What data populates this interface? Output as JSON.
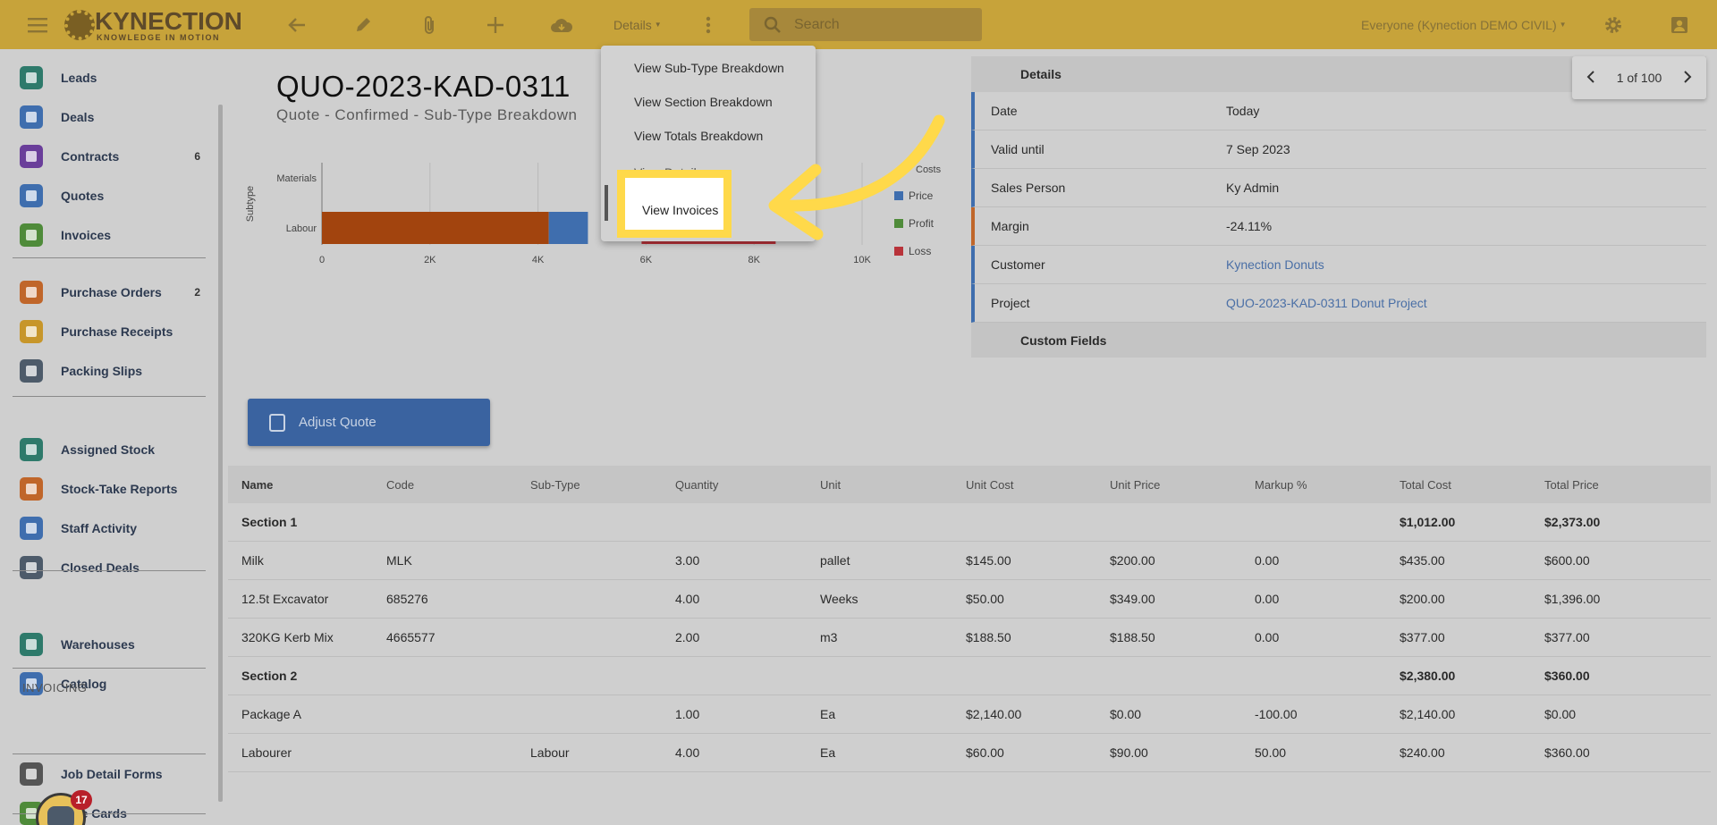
{
  "topbar": {
    "logo_main": "KYNECTION",
    "logo_sub": "KNOWLEDGE IN MOTION",
    "details_label": "Details",
    "search_placeholder": "Search",
    "scope_label": "Everyone (Kynection DEMO CIVIL)",
    "icons": [
      "menu-icon",
      "back-arrow-icon",
      "pencil-icon",
      "paperclip-icon",
      "plus-icon",
      "cloud-download-icon",
      "more-vert-icon",
      "search-icon",
      "gear-icon",
      "account-box-icon"
    ]
  },
  "sidebar": {
    "group1": [
      {
        "label": "Leads",
        "color": "#2e7a6b"
      },
      {
        "label": "Deals",
        "color": "#3f6eae"
      },
      {
        "label": "Contracts",
        "count": "6",
        "color": "#6a3e9a"
      },
      {
        "label": "Quotes",
        "color": "#3f6eae"
      },
      {
        "label": "Invoices",
        "color": "#4f8b3a"
      }
    ],
    "group2": [
      {
        "label": "Purchase Orders",
        "count": "2",
        "color": "#c0662a"
      },
      {
        "label": "Purchase Receipts",
        "color": "#c7962a"
      },
      {
        "label": "Packing Slips",
        "color": "#4d5b6a"
      }
    ],
    "group3": [
      {
        "label": "Assigned Stock",
        "color": "#2e7a6b"
      },
      {
        "label": "Stock-Take Reports",
        "color": "#c0662a"
      },
      {
        "label": "Staff Activity",
        "color": "#3f6eae"
      },
      {
        "label": "Closed Deals",
        "color": "#4d5b6a"
      }
    ],
    "group4": [
      {
        "label": "Warehouses",
        "color": "#2e7a6b"
      },
      {
        "label": "Catalog",
        "color": "#3f6eae"
      }
    ],
    "heading_invoicing": "INVOICING",
    "group5": [
      {
        "label": "Job Detail Forms",
        "color": "#555555"
      },
      {
        "label": "Rate Cards",
        "color": "#4f8b3a"
      }
    ],
    "bot_badge": "17"
  },
  "main": {
    "title": "QUO-2023-KAD-0311",
    "subtitle": "Quote - Confirmed - Sub-Type Breakdown",
    "adjust_label": "Adjust Quote"
  },
  "dropdown": {
    "items": [
      "View Sub-Type Breakdown",
      "View Section Breakdown",
      "View Totals Breakdown",
      "View Details"
    ],
    "highlighted": "View Invoices"
  },
  "details": {
    "header": "Details",
    "rows": [
      {
        "key": "Date",
        "value": "Today",
        "link": false
      },
      {
        "key": "Valid until",
        "value": "7 Sep 2023",
        "link": false
      },
      {
        "key": "Sales Person",
        "value": "Ky Admin",
        "link": false
      },
      {
        "key": "Margin",
        "value": "-24.11%",
        "link": false,
        "accent": "#c0662a"
      },
      {
        "key": "Customer",
        "value": "Kynection Donuts",
        "link": true
      },
      {
        "key": "Project",
        "value": "QUO-2023-KAD-0311 Donut Project",
        "link": true
      }
    ],
    "custom_fields": "Custom Fields",
    "pager": "1 of 100"
  },
  "chart_data": {
    "type": "bar",
    "orientation": "horizontal",
    "stacked": true,
    "categories": [
      "Materials",
      "Labour"
    ],
    "ylabel": "Subtype",
    "xticks": [
      "0",
      "2K",
      "4K",
      "6K",
      "8K",
      "10K"
    ],
    "xlim": [
      0,
      10000
    ],
    "legend_title": "Costs",
    "legend": [
      {
        "name": "Price",
        "color": "#3f6eae"
      },
      {
        "name": "Profit",
        "color": "#4f8b3a"
      },
      {
        "name": "Loss",
        "color": "#b8333a"
      }
    ],
    "series": [
      {
        "name": "Costs",
        "color": "#a2440e",
        "values": [
          0,
          4200
        ]
      },
      {
        "name": "Price",
        "color": "#3f6eae",
        "values": [
          0,
          2380
        ]
      },
      {
        "name": "Profit",
        "color": "#4f8b3a",
        "values": [
          0,
          0
        ]
      },
      {
        "name": "Loss",
        "color": "#b8333a",
        "values": [
          0,
          1820
        ]
      }
    ]
  },
  "table": {
    "columns": [
      "Name",
      "Code",
      "Sub-Type",
      "Quantity",
      "Unit",
      "Unit Cost",
      "Unit Price",
      "Markup %",
      "Total Cost",
      "Total Price"
    ],
    "rows": [
      {
        "section": true,
        "cells": [
          "Section 1",
          "",
          "",
          "",
          "",
          "",
          "",
          "",
          "$1,012.00",
          "$2,373.00"
        ]
      },
      {
        "section": false,
        "cells": [
          "Milk",
          "MLK",
          "",
          "3.00",
          "pallet",
          "$145.00",
          "$200.00",
          "0.00",
          "$435.00",
          "$600.00"
        ]
      },
      {
        "section": false,
        "cells": [
          "12.5t Excavator",
          "685276",
          "",
          "4.00",
          "Weeks",
          "$50.00",
          "$349.00",
          "0.00",
          "$200.00",
          "$1,396.00"
        ]
      },
      {
        "section": false,
        "cells": [
          "320KG Kerb Mix",
          "4665577",
          "",
          "2.00",
          "m3",
          "$188.50",
          "$188.50",
          "0.00",
          "$377.00",
          "$377.00"
        ]
      },
      {
        "section": true,
        "cells": [
          "Section 2",
          "",
          "",
          "",
          "",
          "",
          "",
          "",
          "$2,380.00",
          "$360.00"
        ]
      },
      {
        "section": false,
        "cells": [
          "Package A",
          "",
          "",
          "1.00",
          "",
          "Ea",
          "$2,140.00",
          "$0.00",
          "-100.00",
          "$2,140.00",
          "$0.00"
        ]
      },
      {
        "section": false,
        "cells": [
          "Labourer",
          "",
          "Labour",
          "4.00",
          "Ea",
          "$60.00",
          "$90.00",
          "50.00",
          "$240.00",
          "$360.00"
        ]
      }
    ]
  },
  "colors": {
    "topbar": "#c7a33a",
    "highlight_border": "#ffd94a",
    "arrow": "#ffd94a"
  }
}
